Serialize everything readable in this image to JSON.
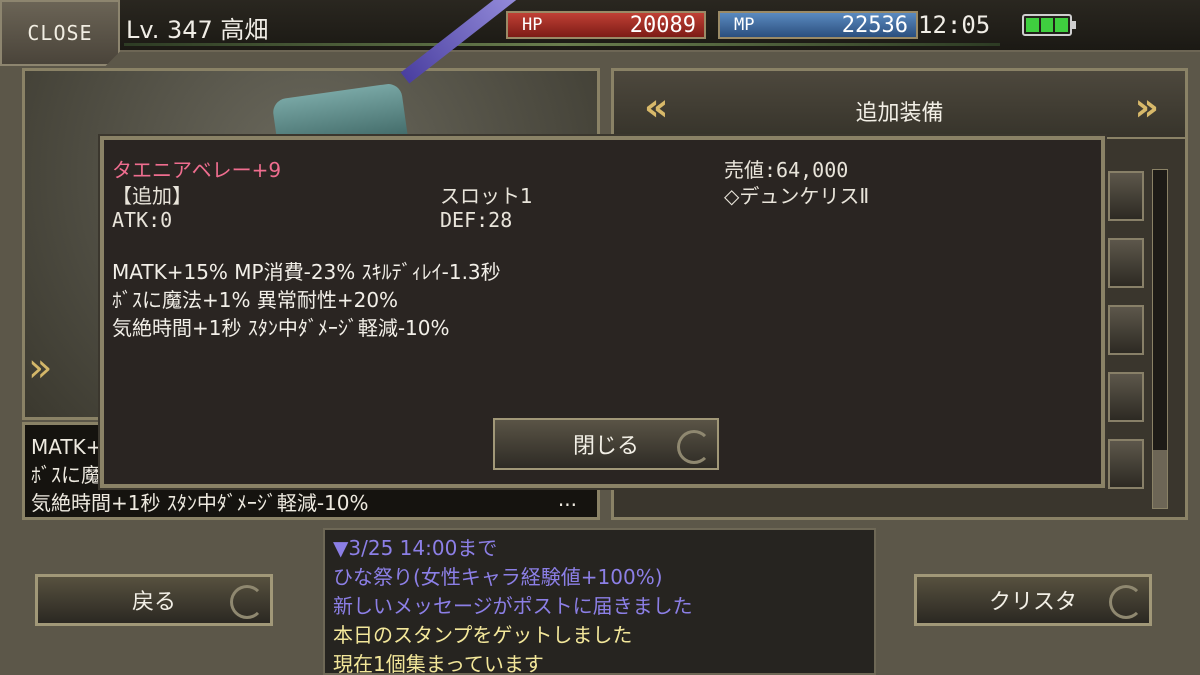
{
  "header": {
    "close_label": "CLOSE",
    "level": "Lv. 347 高畑",
    "hp_label": "HP",
    "hp_value": "20089",
    "mp_label": "MP",
    "mp_value": "22536",
    "clock": "12:05",
    "battery_icon": "battery-full-icon"
  },
  "right_panel": {
    "title": "追加装備",
    "prev_icon": "double-chevron-left-icon",
    "next_icon": "double-chevron-right-icon"
  },
  "summary": {
    "line1": "MATK+",
    "line2": "ﾎﾞｽに魔",
    "line3": "気絶時間+1秒 ｽﾀﾝ中ﾀﾞﾒｰｼﾞ軽減-10%",
    "more": "..."
  },
  "dialog": {
    "item_name": "タエニアベレー",
    "item_refine": "+9",
    "sell_value": "売値:64,000",
    "category": "【追加】",
    "slot": "スロット1",
    "crystal": "◇デュンケリスⅡ",
    "atk": "ATK:0",
    "def": "DEF:28",
    "effects": [
      "MATK+15% MP消費-23% ｽｷﾙﾃﾞｨﾚｲ-1.3秒",
      "ﾎﾞｽに魔法+1% 異常耐性+20%",
      "気絶時間+1秒 ｽﾀﾝ中ﾀﾞﾒｰｼﾞ軽減-10%"
    ],
    "close_button": "閉じる"
  },
  "bottom": {
    "back_button": "戻る",
    "crysta_button": "クリスタ",
    "messages": [
      "▼3/25 14:00まで",
      "ひな祭り(女性キャラ経験値+100%)",
      "新しいメッセージがポストに届きました",
      "本日のスタンプをゲットしました",
      "現在1個集まっています"
    ]
  },
  "colors": {
    "item_name": "#ef6d8f",
    "hp_bar": "#c04035",
    "mp_bar": "#5a8ac0",
    "message_blue": "#8c7fe6",
    "message_yellow": "#f3e79a"
  }
}
